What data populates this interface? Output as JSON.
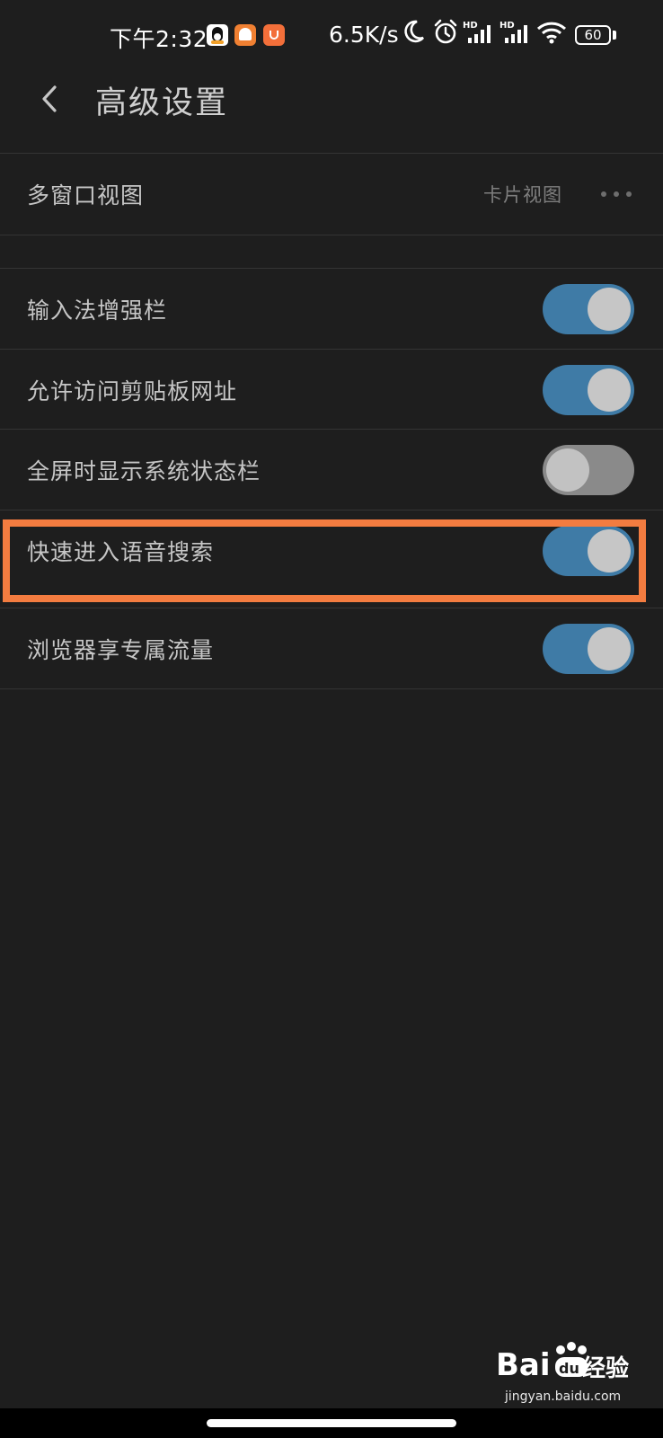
{
  "status_bar": {
    "time": "下午2:32",
    "network_speed": "6.5K/s",
    "signal_tag_1": "HD",
    "signal_tag_2": "HD",
    "battery": "60",
    "icons": [
      "qq-icon",
      "home-app-icon",
      "taobao-icon",
      "moon-icon",
      "alarm-icon",
      "signal-icon",
      "signal-icon",
      "wifi-icon",
      "battery-icon"
    ]
  },
  "header": {
    "back_icon": "chevron-left-icon",
    "title": "高级设置"
  },
  "settings": {
    "multi_window": {
      "label": "多窗口视图",
      "value": "卡片视图",
      "icon": "more-dots-icon"
    },
    "toggles": [
      {
        "label": "输入法增强栏",
        "on": true
      },
      {
        "label": "允许访问剪贴板网址",
        "on": true
      },
      {
        "label": "全屏时显示系统状态栏",
        "on": false
      },
      {
        "label": "快速进入语音搜索",
        "on": true,
        "highlighted": true
      },
      {
        "label": "浏览器享专属流量",
        "on": true
      }
    ]
  },
  "watermark": {
    "brand": "Baidu",
    "text": "经验",
    "url": "jingyan.baidu.com"
  },
  "colors": {
    "background": "#1e1e1e",
    "toggle_on": "#3f7ba6",
    "toggle_off": "#8a8a8a",
    "highlight": "#f37c40"
  }
}
